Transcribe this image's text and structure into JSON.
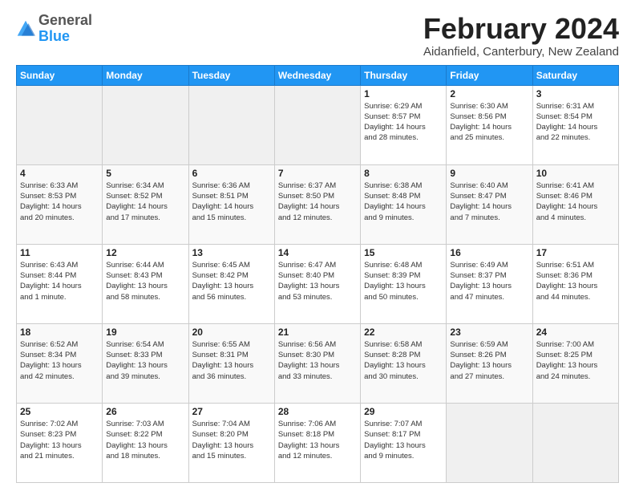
{
  "logo": {
    "general": "General",
    "blue": "Blue"
  },
  "header": {
    "month_title": "February 2024",
    "location": "Aidanfield, Canterbury, New Zealand"
  },
  "weekdays": [
    "Sunday",
    "Monday",
    "Tuesday",
    "Wednesday",
    "Thursday",
    "Friday",
    "Saturday"
  ],
  "weeks": [
    [
      {
        "day": "",
        "detail": ""
      },
      {
        "day": "",
        "detail": ""
      },
      {
        "day": "",
        "detail": ""
      },
      {
        "day": "",
        "detail": ""
      },
      {
        "day": "1",
        "detail": "Sunrise: 6:29 AM\nSunset: 8:57 PM\nDaylight: 14 hours\nand 28 minutes."
      },
      {
        "day": "2",
        "detail": "Sunrise: 6:30 AM\nSunset: 8:56 PM\nDaylight: 14 hours\nand 25 minutes."
      },
      {
        "day": "3",
        "detail": "Sunrise: 6:31 AM\nSunset: 8:54 PM\nDaylight: 14 hours\nand 22 minutes."
      }
    ],
    [
      {
        "day": "4",
        "detail": "Sunrise: 6:33 AM\nSunset: 8:53 PM\nDaylight: 14 hours\nand 20 minutes."
      },
      {
        "day": "5",
        "detail": "Sunrise: 6:34 AM\nSunset: 8:52 PM\nDaylight: 14 hours\nand 17 minutes."
      },
      {
        "day": "6",
        "detail": "Sunrise: 6:36 AM\nSunset: 8:51 PM\nDaylight: 14 hours\nand 15 minutes."
      },
      {
        "day": "7",
        "detail": "Sunrise: 6:37 AM\nSunset: 8:50 PM\nDaylight: 14 hours\nand 12 minutes."
      },
      {
        "day": "8",
        "detail": "Sunrise: 6:38 AM\nSunset: 8:48 PM\nDaylight: 14 hours\nand 9 minutes."
      },
      {
        "day": "9",
        "detail": "Sunrise: 6:40 AM\nSunset: 8:47 PM\nDaylight: 14 hours\nand 7 minutes."
      },
      {
        "day": "10",
        "detail": "Sunrise: 6:41 AM\nSunset: 8:46 PM\nDaylight: 14 hours\nand 4 minutes."
      }
    ],
    [
      {
        "day": "11",
        "detail": "Sunrise: 6:43 AM\nSunset: 8:44 PM\nDaylight: 14 hours\nand 1 minute."
      },
      {
        "day": "12",
        "detail": "Sunrise: 6:44 AM\nSunset: 8:43 PM\nDaylight: 13 hours\nand 58 minutes."
      },
      {
        "day": "13",
        "detail": "Sunrise: 6:45 AM\nSunset: 8:42 PM\nDaylight: 13 hours\nand 56 minutes."
      },
      {
        "day": "14",
        "detail": "Sunrise: 6:47 AM\nSunset: 8:40 PM\nDaylight: 13 hours\nand 53 minutes."
      },
      {
        "day": "15",
        "detail": "Sunrise: 6:48 AM\nSunset: 8:39 PM\nDaylight: 13 hours\nand 50 minutes."
      },
      {
        "day": "16",
        "detail": "Sunrise: 6:49 AM\nSunset: 8:37 PM\nDaylight: 13 hours\nand 47 minutes."
      },
      {
        "day": "17",
        "detail": "Sunrise: 6:51 AM\nSunset: 8:36 PM\nDaylight: 13 hours\nand 44 minutes."
      }
    ],
    [
      {
        "day": "18",
        "detail": "Sunrise: 6:52 AM\nSunset: 8:34 PM\nDaylight: 13 hours\nand 42 minutes."
      },
      {
        "day": "19",
        "detail": "Sunrise: 6:54 AM\nSunset: 8:33 PM\nDaylight: 13 hours\nand 39 minutes."
      },
      {
        "day": "20",
        "detail": "Sunrise: 6:55 AM\nSunset: 8:31 PM\nDaylight: 13 hours\nand 36 minutes."
      },
      {
        "day": "21",
        "detail": "Sunrise: 6:56 AM\nSunset: 8:30 PM\nDaylight: 13 hours\nand 33 minutes."
      },
      {
        "day": "22",
        "detail": "Sunrise: 6:58 AM\nSunset: 8:28 PM\nDaylight: 13 hours\nand 30 minutes."
      },
      {
        "day": "23",
        "detail": "Sunrise: 6:59 AM\nSunset: 8:26 PM\nDaylight: 13 hours\nand 27 minutes."
      },
      {
        "day": "24",
        "detail": "Sunrise: 7:00 AM\nSunset: 8:25 PM\nDaylight: 13 hours\nand 24 minutes."
      }
    ],
    [
      {
        "day": "25",
        "detail": "Sunrise: 7:02 AM\nSunset: 8:23 PM\nDaylight: 13 hours\nand 21 minutes."
      },
      {
        "day": "26",
        "detail": "Sunrise: 7:03 AM\nSunset: 8:22 PM\nDaylight: 13 hours\nand 18 minutes."
      },
      {
        "day": "27",
        "detail": "Sunrise: 7:04 AM\nSunset: 8:20 PM\nDaylight: 13 hours\nand 15 minutes."
      },
      {
        "day": "28",
        "detail": "Sunrise: 7:06 AM\nSunset: 8:18 PM\nDaylight: 13 hours\nand 12 minutes."
      },
      {
        "day": "29",
        "detail": "Sunrise: 7:07 AM\nSunset: 8:17 PM\nDaylight: 13 hours\nand 9 minutes."
      },
      {
        "day": "",
        "detail": ""
      },
      {
        "day": "",
        "detail": ""
      }
    ]
  ]
}
